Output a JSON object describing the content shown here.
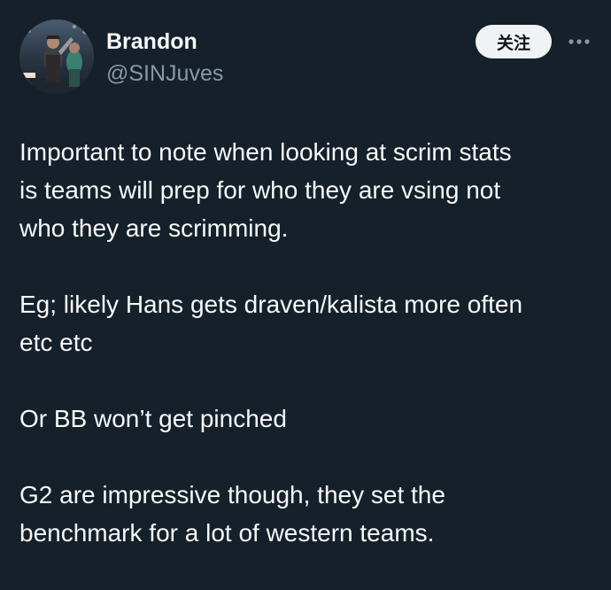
{
  "author": {
    "name": "Brandon",
    "handle": "@SINJuves",
    "avatar_icon": "profile-photo"
  },
  "actions": {
    "follow_label": "关注",
    "more_icon": "more-horizontal-icon"
  },
  "post": {
    "paragraphs": [
      "Important to note when looking at scrim stats\nis teams will prep for who they are vsing not\nwho they are scrimming.",
      "Eg; likely Hans gets draven/kalista more often\netc etc",
      "Or BB won’t get pinched",
      "G2 are impressive though, they set the\nbenchmark for a lot of western teams."
    ]
  },
  "colors": {
    "background": "#15202b",
    "text_primary": "#f7f9f9",
    "text_secondary": "#8b98a5",
    "follow_bg": "#eff3f4"
  }
}
